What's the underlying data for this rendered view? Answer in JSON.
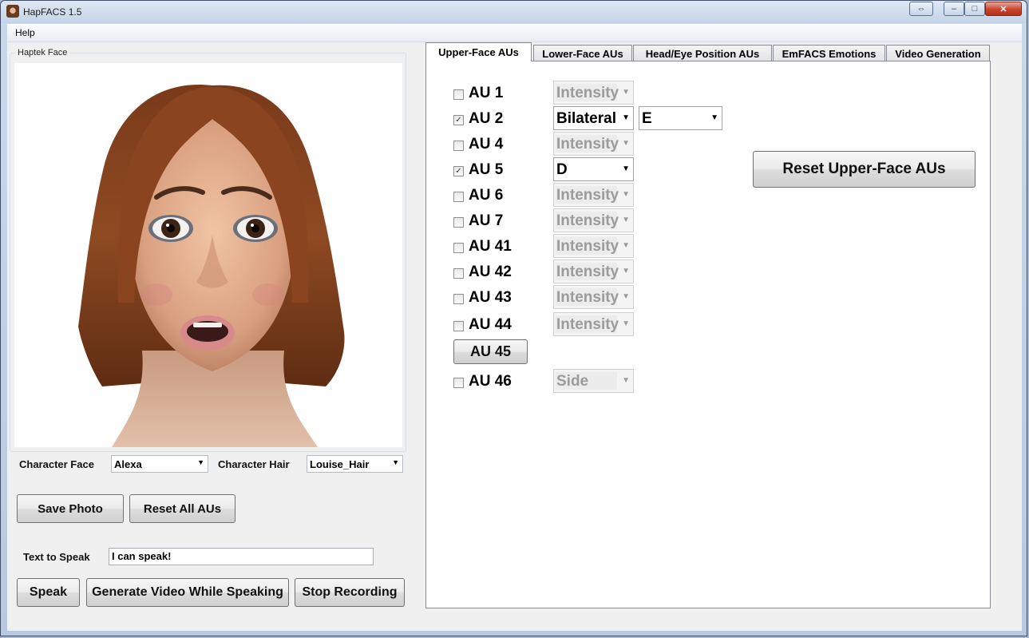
{
  "window": {
    "title": "HapFACS 1.5",
    "buttons": {
      "restore": "⇔",
      "minimize": "–",
      "maximize": "□",
      "close": "✕"
    }
  },
  "menu": {
    "items": [
      "Help"
    ]
  },
  "face_panel": {
    "group_title": "Haptek Face",
    "character_face_label": "Character Face",
    "character_face_value": "Alexa",
    "character_hair_label": "Character Hair",
    "character_hair_value": "Louise_Hair",
    "save_photo": "Save Photo",
    "reset_all": "Reset All AUs",
    "text_to_speak_label": "Text to Speak",
    "text_to_speak_value": "I can speak!",
    "speak": "Speak",
    "generate_video": "Generate Video While Speaking",
    "stop_recording": "Stop Recording"
  },
  "tabs": [
    {
      "label": "Upper-Face AUs",
      "active": true
    },
    {
      "label": "Lower-Face AUs",
      "active": false
    },
    {
      "label": "Head/Eye Position AUs",
      "active": false
    },
    {
      "label": "EmFACS Emotions",
      "active": false
    },
    {
      "label": "Video Generation",
      "active": false
    }
  ],
  "upper_face": {
    "reset_button": "Reset Upper-Face AUs",
    "rows": [
      {
        "label": "AU 1",
        "checked": false,
        "select": "Intensity",
        "enabled": false
      },
      {
        "label": "AU 2",
        "checked": true,
        "select": "Bilateral",
        "enabled": true,
        "select2": "E"
      },
      {
        "label": "AU 4",
        "checked": false,
        "select": "Intensity",
        "enabled": false
      },
      {
        "label": "AU 5",
        "checked": true,
        "select": "D",
        "enabled": true
      },
      {
        "label": "AU 6",
        "checked": false,
        "select": "Intensity",
        "enabled": false
      },
      {
        "label": "AU 7",
        "checked": false,
        "select": "Intensity",
        "enabled": false
      },
      {
        "label": "AU 41",
        "checked": false,
        "select": "Intensity",
        "enabled": false
      },
      {
        "label": "AU 42",
        "checked": false,
        "select": "Intensity",
        "enabled": false
      },
      {
        "label": "AU 43",
        "checked": false,
        "select": "Intensity",
        "enabled": false
      },
      {
        "label": "AU 44",
        "checked": false,
        "select": "Intensity",
        "enabled": false
      }
    ],
    "au45_button": "AU 45",
    "au46": {
      "label": "AU 46",
      "checked": false,
      "select": "Side",
      "enabled": false
    }
  },
  "colors": {
    "title_gradient_top": "#dfe8f4",
    "close_button": "#c9452f",
    "panel_bg": "#f0f0f0",
    "disabled_text": "#9b9b9b"
  }
}
